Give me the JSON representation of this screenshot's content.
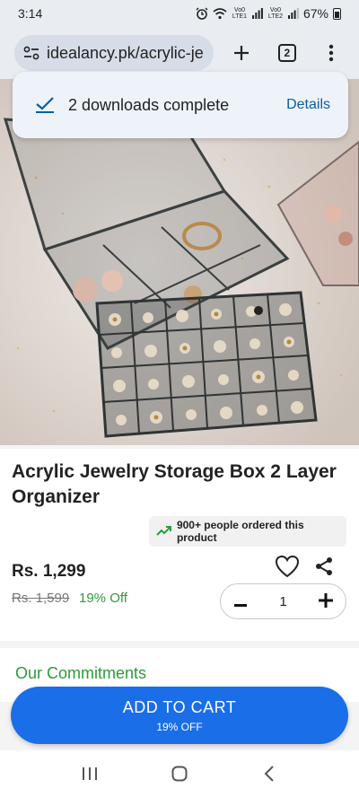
{
  "status_bar": {
    "time": "3:14",
    "sim1_label": "Vo0 LTE1",
    "sim2_label": "Vo0 LTE2",
    "battery": "67%"
  },
  "browser": {
    "url": "idealancy.pk/acrylic-je",
    "tab_count": "2"
  },
  "notification": {
    "message": "2 downloads complete",
    "action": "Details"
  },
  "product": {
    "title": "Acrylic Jewelry Storage Box 2 Layer Organizer",
    "orders_badge": "900+ people ordered this product",
    "price": "Rs. 1,299",
    "original_price": "Rs. 1,599",
    "discount": "19% Off",
    "quantity": "1"
  },
  "commitments": {
    "title": "Our Commitments"
  },
  "cart": {
    "label": "ADD TO CART",
    "sublabel": "19% OFF"
  },
  "colors": {
    "accent_blue": "#1a6ee8",
    "discount_green": "#2e9a3a",
    "link_blue": "#0b5ea0"
  },
  "icons": [
    "wifi-icon",
    "signal-icon",
    "battery-icon",
    "site-settings-icon",
    "plus-icon",
    "tab-switcher-icon",
    "more-vert-icon",
    "check-icon",
    "trending-up-icon",
    "heart-icon",
    "share-icon",
    "minus-icon",
    "recents-nav-icon",
    "home-nav-icon",
    "back-nav-icon"
  ]
}
